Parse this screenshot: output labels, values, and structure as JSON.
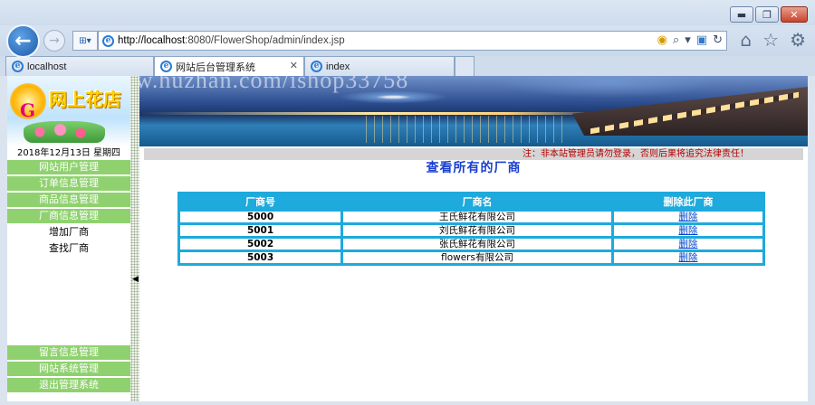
{
  "browser": {
    "url_host": "http://localhost",
    "url_rest": ":8080/FlowerShop/admin/index.jsp",
    "tabs": [
      {
        "label": "localhost"
      },
      {
        "label": "网站后台管理系统"
      },
      {
        "label": "index"
      }
    ],
    "window_buttons": {
      "minimize": "▬",
      "maximize": "❐",
      "close": "✕"
    }
  },
  "banner": {
    "logo_letter": "G",
    "logo_title": "网上花店",
    "watermark": "https://www.huzhan.com/ishop33758"
  },
  "sidebar": {
    "date": "2018年12月13日 星期四",
    "menu_top": [
      {
        "label": "网站用户管理"
      },
      {
        "label": "订单信息管理"
      },
      {
        "label": "商品信息管理"
      },
      {
        "label": "厂商信息管理"
      }
    ],
    "sub_items": [
      {
        "label": "增加厂商"
      },
      {
        "label": "查找厂商"
      }
    ],
    "menu_bottom": [
      {
        "label": "留言信息管理"
      },
      {
        "label": "网站系统管理"
      },
      {
        "label": "退出管理系统"
      }
    ]
  },
  "notice": "注：非本站管理员请勿登录，否则后果将追究法律责任！",
  "main": {
    "title": "查看所有的厂商",
    "columns": [
      "厂商号",
      "厂商名",
      "删除此厂商"
    ],
    "rows": [
      {
        "id": "5000",
        "name": "王氏鲜花有限公司",
        "action": "删除"
      },
      {
        "id": "5001",
        "name": "刘氏鲜花有限公司",
        "action": "删除"
      },
      {
        "id": "5002",
        "name": "张氏鲜花有限公司",
        "action": "删除"
      },
      {
        "id": "5003",
        "name": "flowers有限公司",
        "action": "删除"
      }
    ]
  },
  "colors": {
    "menu_green": "#8fd16f",
    "table_blue": "#1eaadc",
    "title_blue": "#1a3fcf",
    "notice_red": "#b30000"
  }
}
